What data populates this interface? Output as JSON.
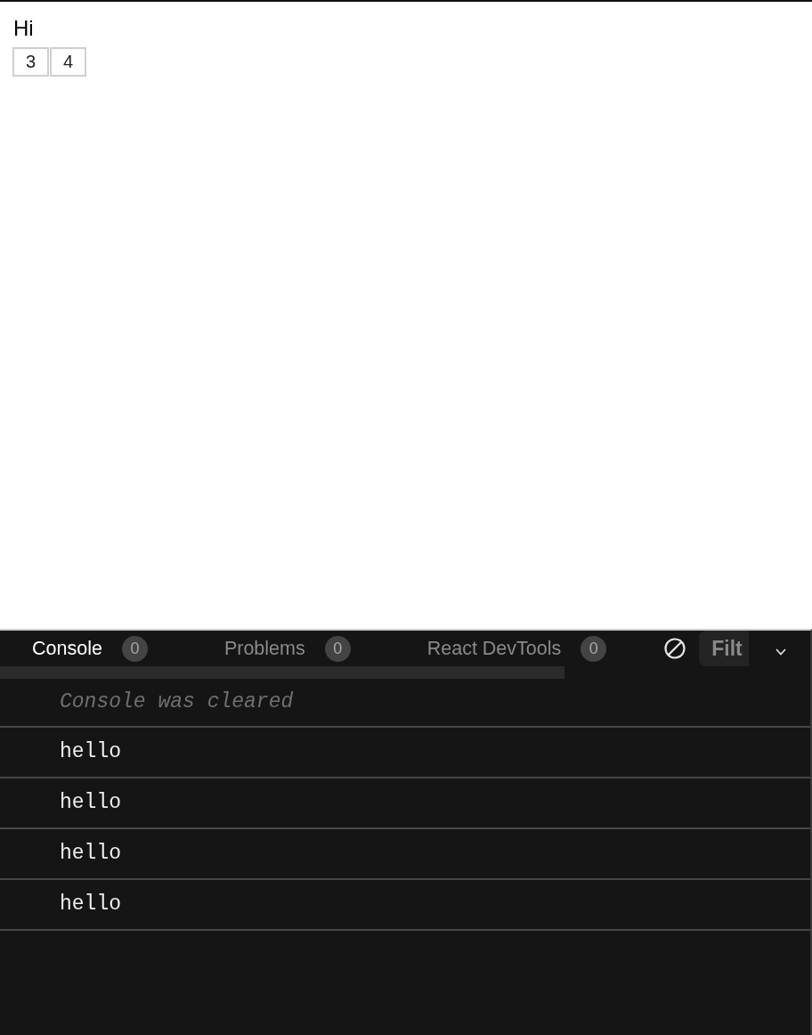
{
  "page": {
    "heading": "Hi",
    "buttons": [
      "3",
      "4"
    ]
  },
  "console_panel": {
    "tabs": [
      {
        "label": "Console",
        "count": "0",
        "selected": true
      },
      {
        "label": "Problems",
        "count": "0",
        "selected": false
      },
      {
        "label": "React DevTools",
        "count": "0",
        "selected": false
      }
    ],
    "filter": {
      "placeholder": "Filt"
    },
    "messages": [
      {
        "kind": "notice",
        "text": "Console was cleared"
      },
      {
        "kind": "log",
        "text": "hello"
      },
      {
        "kind": "log",
        "text": "hello"
      },
      {
        "kind": "log",
        "text": "hello"
      },
      {
        "kind": "log",
        "text": "hello"
      }
    ]
  }
}
